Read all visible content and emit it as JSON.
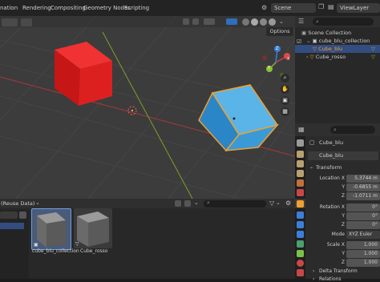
{
  "topbar": {
    "tabs": [
      "nation",
      "Rendering",
      "Compositing",
      "Geometry Nodes",
      "Scripting"
    ],
    "scene_label": "Scene",
    "view_layer_label": "ViewLayer"
  },
  "viewport": {
    "options_label": "Options",
    "gizmo_axes": [
      "X",
      "Y",
      "Z"
    ]
  },
  "outliner": {
    "root": "Scene Collection",
    "items": [
      "cube_blu_collection",
      "Cube_blu",
      "Cube_rosso"
    ]
  },
  "properties": {
    "object_name": "Cube_blu",
    "data_name": "Cube_blu",
    "transform_header": "Transform",
    "location_label": "Location X",
    "location": {
      "x": "5.3744 m",
      "y": "-0.6855 m",
      "z": "-1.0711 m"
    },
    "rotation_label": "Rotation X",
    "rotation": {
      "x": "0°",
      "y": "0°",
      "z": "0°"
    },
    "mode_label": "Mode",
    "mode_value": "XYZ Euler",
    "scale_label": "Scale X",
    "scale": {
      "x": "1.000",
      "y": "1.000",
      "z": "1.000"
    },
    "axis_labels": {
      "y": "Y",
      "z": "Z"
    },
    "delta_transform": "Delta Transform",
    "relations": "Relations"
  },
  "asset_browser": {
    "header_text": "(Reuse Data)",
    "assets": [
      "cube_blu_collection",
      "Cube_rosso"
    ]
  },
  "colors": {
    "red_cube": "#e02020",
    "blue_cube": "#3aa0dc",
    "selection_orange": "#f0a030",
    "x_axis": "#a83a3a",
    "y_axis": "#7aa02a"
  }
}
